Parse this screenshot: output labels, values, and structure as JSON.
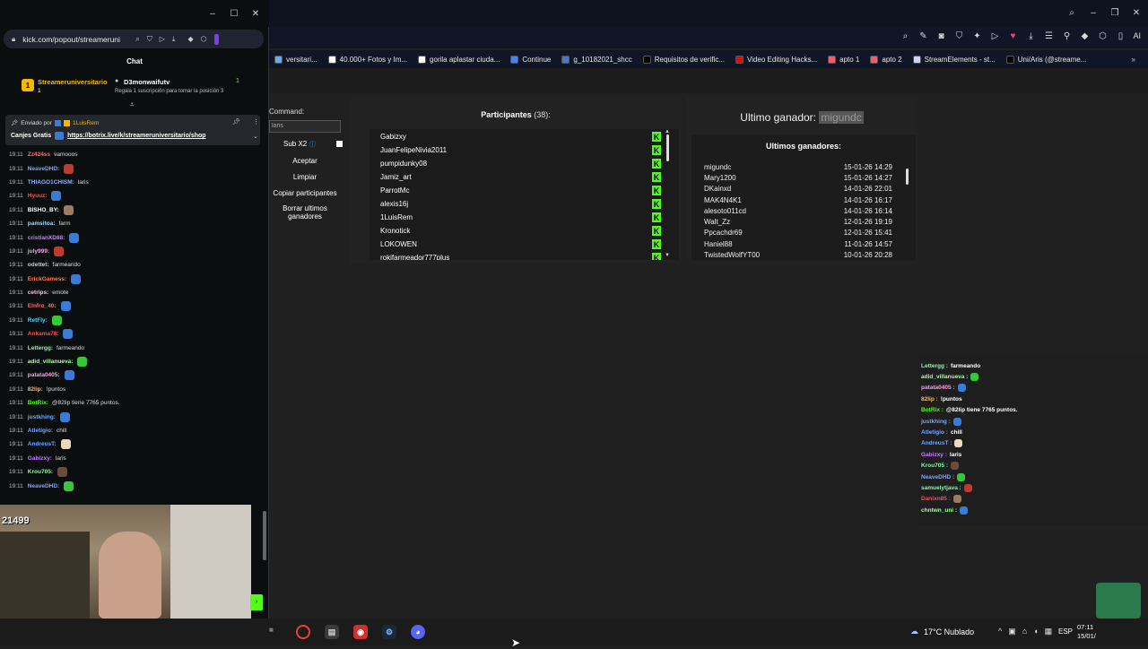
{
  "chat_window": {
    "url": "kick.com/popout/streameruni",
    "title": "Chat",
    "top_sub": {
      "user": "Streameruniversitario",
      "badge_num": "1",
      "target": "D3monwaifutv",
      "sub_count": "1",
      "note": "Regala 1 suscripción para tomar la posición 3"
    },
    "pinned": {
      "sent_by": "Enviado por",
      "sender": "1LuisRem",
      "text": "Canjes Gratis",
      "link": "https://botrix.live/k/streameruniversitario/shop"
    },
    "messages": [
      {
        "time": "19:11",
        "user": "Zz424ss",
        "text": "vamooos",
        "color": "#ff6b6b",
        "emote": ""
      },
      {
        "time": "19:11",
        "user": "NeaveDHD:",
        "text": "",
        "color": "#7da7ff",
        "emote": "#c0392b"
      },
      {
        "time": "19:11",
        "user": "THIAGO1CHISM:",
        "text": "laris",
        "color": "#8ab4ff",
        "emote": ""
      },
      {
        "time": "19:11",
        "user": "Hyuuz:",
        "text": "",
        "color": "#ff4d4d",
        "emote": "#3b7bd8"
      },
      {
        "time": "19:11",
        "user": "BISHO_BY:",
        "text": "",
        "color": "#ffffff",
        "emote": "#a17a5e"
      },
      {
        "time": "19:11",
        "user": "pamsitoa:",
        "text": "farm",
        "color": "#a3d8ff",
        "emote": ""
      },
      {
        "time": "19:11",
        "user": "cristianXD88:",
        "text": "",
        "color": "#c77dff",
        "emote": "#3b7bd8"
      },
      {
        "time": "19:11",
        "user": "july999:",
        "text": "",
        "color": "#ff9ff3",
        "emote": "#c0392b"
      },
      {
        "time": "19:11",
        "user": "odettet:",
        "text": "farmeando",
        "color": "#cccccc",
        "emote": ""
      },
      {
        "time": "19:11",
        "user": "ErickGamess:",
        "text": "",
        "color": "#ff7f50",
        "emote": "#3b7bd8"
      },
      {
        "time": "19:11",
        "user": "cetrips:",
        "text": "emote",
        "color": "#ffc0cb",
        "emote": ""
      },
      {
        "time": "19:11",
        "user": "Elnfro_40:",
        "text": "",
        "color": "#ff6b6b",
        "emote": "#3b7bd8"
      },
      {
        "time": "19:11",
        "user": "RetFly:",
        "text": "",
        "color": "#5ad1ff",
        "emote": "#37c837"
      },
      {
        "time": "19:11",
        "user": "Ankama78:",
        "text": "",
        "color": "#ff4d4d",
        "emote": "#3b7bd8"
      },
      {
        "time": "19:11",
        "user": "Lettergg:",
        "text": "farmeando",
        "color": "#86f7a0",
        "emote": ""
      },
      {
        "time": "19:11",
        "user": "adid_villanueva:",
        "text": "",
        "color": "#a3ffa3",
        "emote": "#37c837"
      },
      {
        "time": "19:11",
        "user": "patata0405:",
        "text": "",
        "color": "#ff9ff3",
        "emote": "#3b7bd8"
      },
      {
        "time": "19:11",
        "user": "82lip:",
        "text": "!puntos",
        "color": "#ffb86b",
        "emote": ""
      },
      {
        "time": "19:11",
        "user": "BotRix:",
        "text": "@82lip tiene 7765 puntos.",
        "color": "#53fc18",
        "emote": ""
      },
      {
        "time": "19:11",
        "user": "justkhing:",
        "text": "",
        "color": "#6fa8ff",
        "emote": "#3b7bd8"
      },
      {
        "time": "19:11",
        "user": "Atletigio:",
        "text": "chill",
        "color": "#6fa8ff",
        "emote": ""
      },
      {
        "time": "19:11",
        "user": "AndreusT:",
        "text": "",
        "color": "#6fa8ff",
        "emote": "#e8dcc0"
      },
      {
        "time": "19:11",
        "user": "Gabizxy:",
        "text": "laris",
        "color": "#c77dff",
        "emote": ""
      },
      {
        "time": "19:11",
        "user": "Krou705:",
        "text": "",
        "color": "#86f7a0",
        "emote": "#6b4b3b"
      },
      {
        "time": "19:11",
        "user": "NeaveDHD:",
        "text": "",
        "color": "#7da7ff",
        "emote": "#37c837"
      }
    ],
    "viewers": "21499"
  },
  "browser": {
    "bookmarks": [
      {
        "label": "versitari...",
        "color": "#5ab0ff"
      },
      {
        "label": "40.000+ Fotos y Im...",
        "color": "#ffffff"
      },
      {
        "label": "gorila aplastar ciuda...",
        "color": "#ffffff"
      },
      {
        "label": "Continue",
        "color": "#4285f4"
      },
      {
        "label": "g_10182021_shcc",
        "color": "#3b7bd8"
      },
      {
        "label": "Requisitos de verific...",
        "color": "#000000"
      },
      {
        "label": "Video Editing Hacks...",
        "color": "#ff0000"
      },
      {
        "label": "apto 1",
        "color": "#ff5a5f"
      },
      {
        "label": "apto 2",
        "color": "#ff5a5f"
      },
      {
        "label": "StreamElements - st...",
        "color": "#d2d2ff"
      },
      {
        "label": "Uni/Aris (@streame...",
        "color": "#000000"
      }
    ],
    "ai_label": "AI"
  },
  "giveaway": {
    "command_label": "Command:",
    "command_value": "laris",
    "sub_label": "Sub X2",
    "buttons": [
      "Aceptar",
      "Limpiar",
      "Copiar participantes",
      "Borrar ultimos ganadores"
    ],
    "participants_title": "Participantes",
    "participants_count": "(38):",
    "participants": [
      "Gabizxy",
      "JuanFelipeNivia2011",
      "pumpidunky08",
      "Jamiz_art",
      "ParrotMc",
      "alexis16j",
      "1LuisRem",
      "Kronotick",
      "LOKOWEN",
      "rokifarmeador777plus"
    ],
    "last_winner_label": "Ultimo ganador:",
    "last_winner": "migundc",
    "last_winners_title": "Ultimos ganadores:",
    "winners": [
      {
        "name": "migundc",
        "date": "15-01-26 14:29"
      },
      {
        "name": "Mary1200",
        "date": "15-01-26 14:27"
      },
      {
        "name": "DKainxd",
        "date": "14-01-26 22:01"
      },
      {
        "name": "MAK4N4K1",
        "date": "14-01-26 16:17"
      },
      {
        "name": "alesoto011cd",
        "date": "14-01-26 16:14"
      },
      {
        "name": "Walt_Zz",
        "date": "12-01-26 19:19"
      },
      {
        "name": "Ppcachdr69",
        "date": "12-01-26 15:41"
      },
      {
        "name": "Haniel88",
        "date": "11-01-26 14:57"
      },
      {
        "name": "TwistedWolfYT00",
        "date": "10-01-26 20:28"
      }
    ]
  },
  "overlay_chat": [
    {
      "user": "Lettergg :",
      "text": "farmeando",
      "color": "#86f7a0",
      "emote": ""
    },
    {
      "user": "adid_villanueva :",
      "text": "",
      "color": "#a3ffa3",
      "emote": "#37c837"
    },
    {
      "user": "patata0405 :",
      "text": "",
      "color": "#ff9ff3",
      "emote": "#3b7bd8"
    },
    {
      "user": "82lip :",
      "text": "!puntos",
      "color": "#ffb86b",
      "emote": ""
    },
    {
      "user": "BotRix :",
      "text": "@82lip tiene 7765 puntos.",
      "color": "#53fc18",
      "emote": ""
    },
    {
      "user": "justkhing :",
      "text": "",
      "color": "#6fa8ff",
      "emote": "#3b7bd8"
    },
    {
      "user": "Atletigio :",
      "text": "chill",
      "color": "#6fa8ff",
      "emote": ""
    },
    {
      "user": "AndreusT :",
      "text": "",
      "color": "#6fa8ff",
      "emote": "#e8dcc0"
    },
    {
      "user": "Gabizxy :",
      "text": "laris",
      "color": "#c77dff",
      "emote": ""
    },
    {
      "user": "Krou705 :",
      "text": "",
      "color": "#86f7a0",
      "emote": "#6b4b3b"
    },
    {
      "user": "NeaveDHD :",
      "text": "",
      "color": "#7da7ff",
      "emote": "#37c837"
    },
    {
      "user": "samuelytjava :",
      "text": "",
      "color": "#86f7a0",
      "emote": "#c0392b"
    },
    {
      "user": "Danixn85 :",
      "text": "",
      "color": "#ff4d4d",
      "emote": "#a17a5e"
    },
    {
      "user": "chntwn_uni :",
      "text": "",
      "color": "#a3ffa3",
      "emote": "#3b7bd8"
    }
  ],
  "taskbar": {
    "weather": "17°C Nublado",
    "lang": "ESP",
    "time": "07:11",
    "date": "15/01/"
  }
}
